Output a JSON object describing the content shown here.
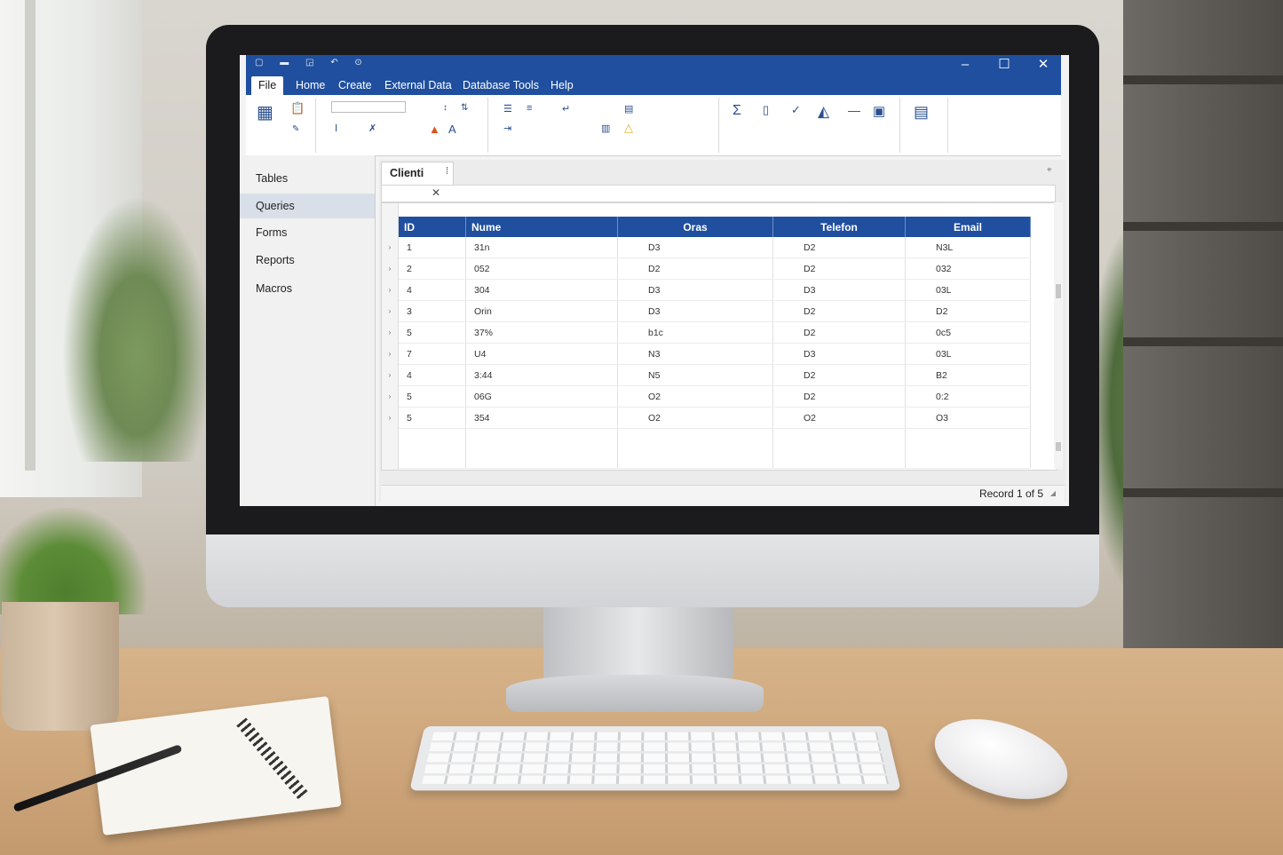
{
  "titlebar": {
    "minimize_glyph": "–",
    "maximize_glyph": "☐",
    "close_glyph": "✕"
  },
  "tabs": [
    {
      "label": "File",
      "active": true
    },
    {
      "label": "Home",
      "active": false
    },
    {
      "label": "Create",
      "active": false
    },
    {
      "label": "External Data",
      "active": false
    },
    {
      "label": "Database Tools",
      "active": false
    },
    {
      "label": "Help",
      "active": false
    }
  ],
  "nav": {
    "items": [
      {
        "label": "Tables",
        "selected": false
      },
      {
        "label": "Queries",
        "selected": true
      },
      {
        "label": "Forms",
        "selected": false
      },
      {
        "label": "Reports",
        "selected": false
      },
      {
        "label": "Macros",
        "selected": false
      }
    ]
  },
  "document": {
    "tab_label": "Clienti",
    "tab_close_glyph": "✕"
  },
  "table": {
    "columns": [
      "ID",
      "Nume",
      "Oras",
      "Telefon",
      "Email"
    ],
    "rows": [
      [
        "1",
        "31n",
        "D3",
        "D2",
        "N3L"
      ],
      [
        "2",
        "052",
        "D2",
        "D2",
        "032"
      ],
      [
        "4",
        "304",
        "D3",
        "D3",
        "03L"
      ],
      [
        "3",
        "Orin",
        "D3",
        "D2",
        "D2"
      ],
      [
        "5",
        "37%",
        "b1c",
        "D2",
        "0c5"
      ],
      [
        "7",
        "U4",
        "N3",
        "D3",
        "03L"
      ],
      [
        "4",
        "3:44",
        "N5",
        "D2",
        "B2"
      ],
      [
        "5",
        "06G",
        "O2",
        "D2",
        "0:2"
      ],
      [
        "5",
        "354",
        "O2",
        "O2",
        "O3"
      ]
    ]
  },
  "status": {
    "record_text": "Record 1 of 5"
  },
  "colors": {
    "accent": "#1f4f9e",
    "header_text": "#ffffff"
  }
}
